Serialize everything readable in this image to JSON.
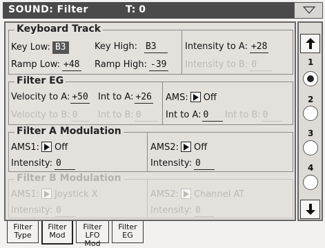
{
  "title": "SOUND: Filter",
  "transpose": "T: 0",
  "sections": {
    "keyboard_track": {
      "title": "Keyboard Track",
      "key_low_label": "Key Low:",
      "key_low_value": "B3",
      "key_high_label": "Key High:",
      "key_high_value": "B3",
      "intensity_a_label": "Intensity to A:",
      "intensity_a_value": "+28",
      "ramp_low_label": "Ramp Low:",
      "ramp_low_value": "+48",
      "ramp_high_label": "Ramp High:",
      "ramp_high_value": "-39",
      "intensity_b_label": "Intensity to B:",
      "intensity_b_value": "0"
    },
    "filter_eg": {
      "title": "Filter EG",
      "vel_a_label": "Velocity to A:",
      "vel_a_value": "+50",
      "int_a_label": "Int to A:",
      "int_a_value": "+26",
      "ams_label": "AMS:",
      "ams_value": "Off",
      "vel_b_label": "Velocity to B:",
      "vel_b_value": "0",
      "int_b_label": "Int to B:",
      "int_b_value": "0",
      "ams_int_a_label": "Int to A:",
      "ams_int_a_value": "0",
      "ams_int_b_label": "Int to B:",
      "ams_int_b_value": "0"
    },
    "filter_a_mod": {
      "title": "Filter A Modulation",
      "ams1_label": "AMS1:",
      "ams1_value": "Off",
      "ams2_label": "AMS2:",
      "ams2_value": "Off",
      "int1_label": "Intensity:",
      "int1_value": "0",
      "int2_label": "Intensity:",
      "int2_value": "0"
    },
    "filter_b_mod": {
      "title": "Filter B Modulation",
      "ams1_label": "AMS1:",
      "ams1_value": "Joystick X",
      "ams2_label": "AMS2:",
      "ams2_value": "Channel AT",
      "int1_label": "Intensity:",
      "int1_value": "0",
      "int2_label": "Intensity:",
      "int2_value": "0"
    }
  },
  "parts": {
    "numbers": [
      "1",
      "2",
      "3",
      "4"
    ],
    "selected_index": 0
  },
  "tabs": [
    {
      "line1": "Filter",
      "line2": "Type"
    },
    {
      "line1": "Filter",
      "line2": "Mod"
    },
    {
      "line1": "Filter",
      "line2": "LFO Mod"
    },
    {
      "line1": "Filter",
      "line2": "EG"
    }
  ],
  "active_tab_index": 1,
  "icons": {
    "menu": "triangle-down-icon",
    "scroll_up": "arrow-up-icon",
    "scroll_down": "arrow-down-icon",
    "switch": "triangle-right-icon"
  },
  "colors": {
    "title_bar": "#4a4a4a",
    "panel": "#e4e1dd",
    "dim_text": "#bdbab6",
    "selected_value_bg": "#555555"
  }
}
